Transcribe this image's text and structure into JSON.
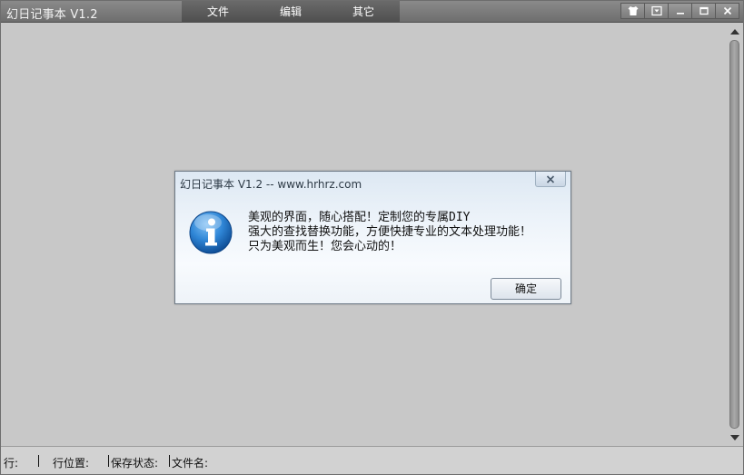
{
  "window": {
    "title": "幻日记事本 V1.2"
  },
  "menu": {
    "items": [
      {
        "label": "文件"
      },
      {
        "label": "编辑"
      },
      {
        "label": "其它"
      }
    ]
  },
  "window_controls": {
    "icons": [
      "shirt-icon",
      "dropdown-icon",
      "minimize-icon",
      "maximize-icon",
      "close-icon"
    ]
  },
  "dialog": {
    "title": "幻日记事本 V1.2  --  www.hrhrz.com",
    "icon": "info-icon",
    "lines": [
      "美观的界面，随心搭配！定制您的专属DIY",
      "强大的查找替换功能，方便快捷专业的文本处理功能！",
      "只为美观而生！您会心动的！"
    ],
    "ok_label": "确定"
  },
  "status": {
    "row_label": "行:",
    "pos_label": "行位置:",
    "save_label": "保存状态:",
    "file_label": "文件名:"
  },
  "colors": {
    "titlebar": "#7a7a7a",
    "menubar": "#5a5a5a",
    "editor_bg": "#c8c8c8",
    "info_blue": "#1f73c9"
  }
}
